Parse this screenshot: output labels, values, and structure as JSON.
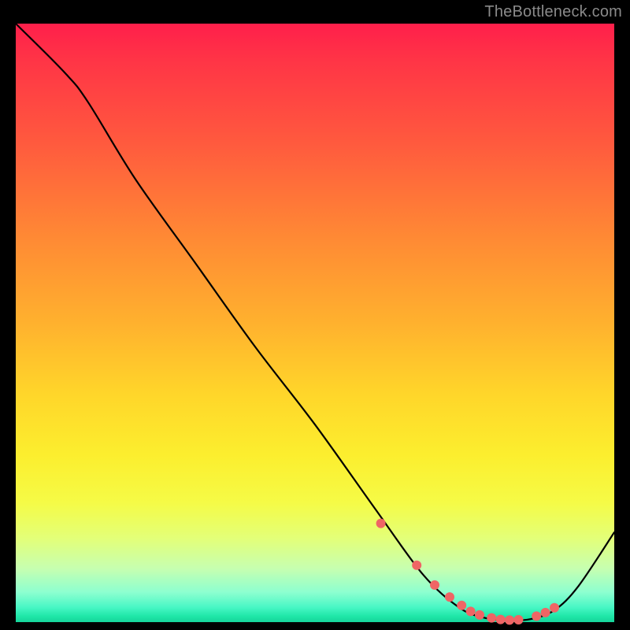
{
  "watermark": "TheBottleneck.com",
  "colors": {
    "page_bg": "#000000",
    "watermark_text": "#8a8a8a",
    "curve": "#000000",
    "marker": "#ef6565",
    "gradient_top": "#ff1f4b",
    "gradient_bottom": "#16d49a"
  },
  "chart_data": {
    "type": "line",
    "title": "",
    "xlabel": "",
    "ylabel": "",
    "xlim": [
      0,
      100
    ],
    "ylim": [
      0,
      100
    ],
    "annotations": [],
    "series": [
      {
        "name": "bottleneck-curve",
        "x": [
          0,
          8,
          12,
          20,
          30,
          40,
          50,
          60,
          68,
          74,
          78,
          82,
          86,
          90,
          94,
          100
        ],
        "values": [
          100,
          92,
          87,
          74,
          60,
          46,
          33,
          19,
          8,
          2.5,
          0.8,
          0.3,
          0.5,
          2.0,
          6.0,
          15
        ]
      }
    ],
    "markers": {
      "name": "highlighted-points",
      "x": [
        61,
        67,
        70,
        72.5,
        74.5,
        76,
        77.5,
        79.5,
        81,
        82.5,
        84,
        87,
        88.5,
        90
      ],
      "values": [
        16.5,
        9.5,
        6.2,
        4.2,
        2.8,
        1.8,
        1.2,
        0.7,
        0.45,
        0.35,
        0.4,
        1.0,
        1.6,
        2.4
      ]
    }
  }
}
